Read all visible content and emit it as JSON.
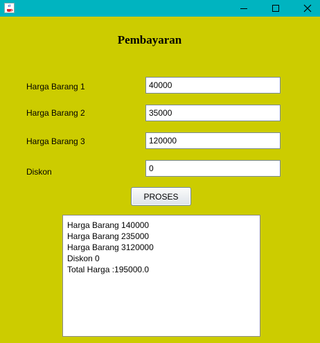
{
  "window": {
    "icon": "java-cup-icon",
    "colors": {
      "titlebar": "#00b4c0",
      "background": "#cccc00"
    }
  },
  "form": {
    "title": "Pembayaran",
    "fields": [
      {
        "label": "Harga Barang 1",
        "value": "40000"
      },
      {
        "label": "Harga Barang 2",
        "value": "35000"
      },
      {
        "label": "Harga Barang 3",
        "value": "120000"
      },
      {
        "label": "Diskon",
        "value": "0"
      }
    ],
    "process_button": "PROSES"
  },
  "output": {
    "lines": [
      "Harga Barang 140000",
      "Harga Barang 235000",
      "Harga Barang 3120000",
      "Diskon 0",
      "Total Harga :195000.0"
    ]
  }
}
